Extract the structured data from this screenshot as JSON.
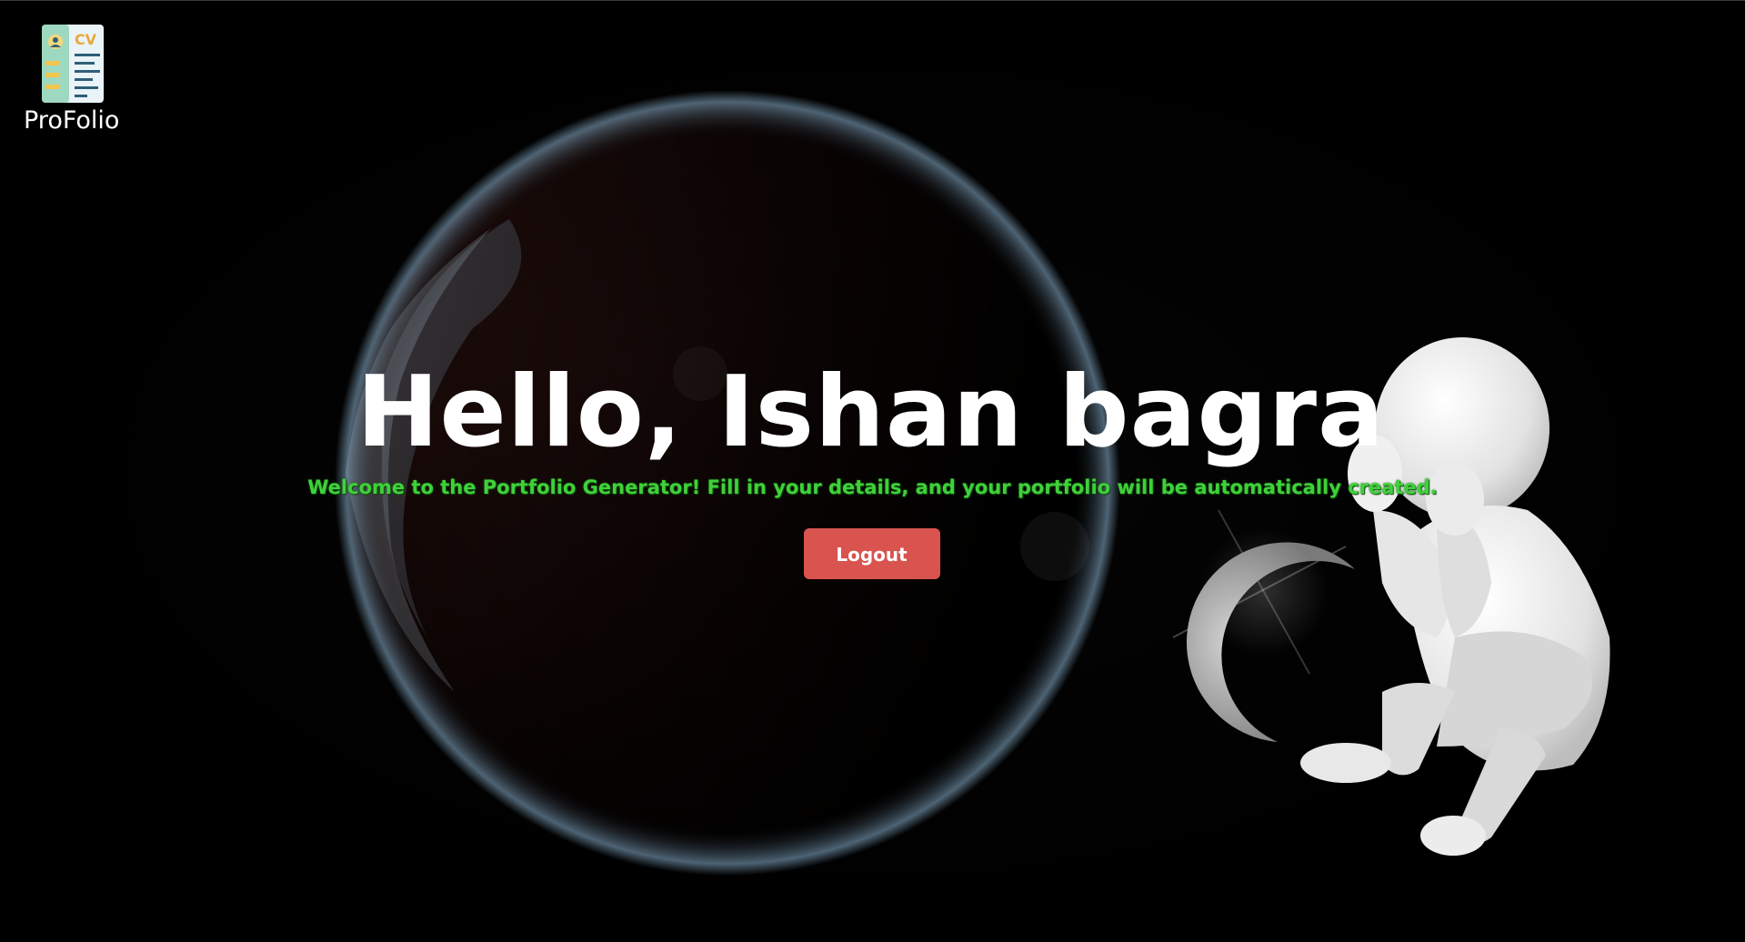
{
  "brand": {
    "name": "ProFolio",
    "logo_icon": "cv-document-icon",
    "logo_letters": "CV"
  },
  "hero": {
    "greeting": "Hello, Ishan bagra",
    "welcome": "Welcome to the Portfolio Generator! Fill in your details, and your portfolio will be automatically created."
  },
  "actions": {
    "logout_label": "Logout"
  },
  "colors": {
    "background": "#000000",
    "heading": "#ffffff",
    "welcome_text": "#3fd13a",
    "logout_button": "#d9534f"
  },
  "background_art": {
    "planet": "earth-planet-illustration",
    "moon": "crescent-moon-illustration",
    "figure": "sad-3d-figure-illustration"
  }
}
